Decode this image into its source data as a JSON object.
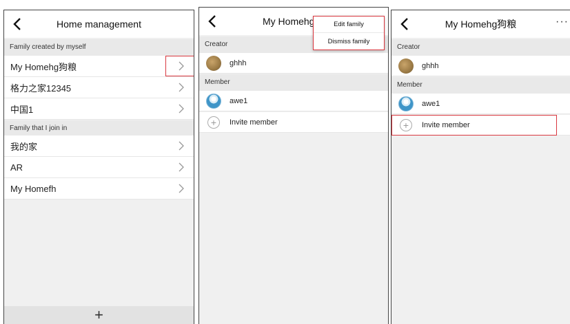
{
  "screen1": {
    "title": "Home management",
    "section_created": "Family created by myself",
    "created_families": [
      "My Homehg狗粮",
      "格力之家12345",
      "中国1"
    ],
    "section_joined": "Family that I join in",
    "joined_families": [
      "我的家",
      "AR",
      "My Homefh"
    ],
    "add_button": "+"
  },
  "screen2": {
    "title": "My Homehg狗粮",
    "creator_header": "Creator",
    "creator_name": "ghhh",
    "member_header": "Member",
    "member_name": "awe1",
    "invite_label": "Invite member",
    "menu": {
      "edit_family": "Edit family",
      "dismiss_family": "Dismiss family"
    }
  },
  "screen3": {
    "title": "My Homehg狗粮",
    "more_icon": "···",
    "creator_header": "Creator",
    "creator_name": "ghhh",
    "member_header": "Member",
    "member_name": "awe1",
    "invite_label": "Invite member"
  },
  "colors": {
    "highlight": "#d9363e",
    "background": "#f0f0f0",
    "section_header": "#e9e9e9"
  }
}
